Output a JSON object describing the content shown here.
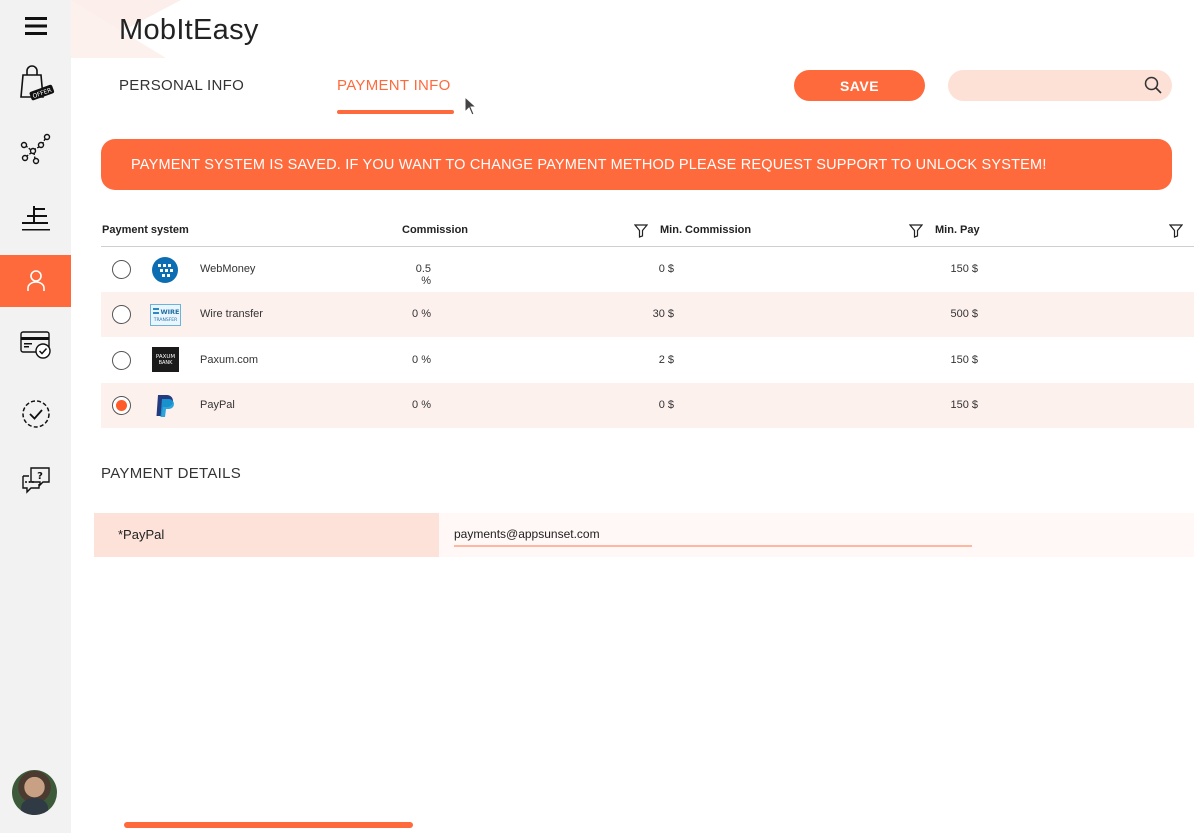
{
  "app": {
    "title": "MobItEasy"
  },
  "tabs": [
    {
      "label": "PERSONAL INFO",
      "active": false
    },
    {
      "label": "PAYMENT INFO",
      "active": true
    }
  ],
  "toolbar": {
    "save_label": "SAVE",
    "search_placeholder": ""
  },
  "banner": {
    "text": "PAYMENT SYSTEM IS SAVED. IF YOU WANT TO CHANGE PAYMENT METHOD PLEASE REQUEST SUPPORT TO UNLOCK SYSTEM!"
  },
  "sidebar": {
    "items": [
      {
        "icon": "menu-icon"
      },
      {
        "icon": "offer-bag-icon",
        "badge": "OFFER"
      },
      {
        "icon": "network-icon"
      },
      {
        "icon": "stats-icon"
      },
      {
        "icon": "user-icon",
        "active": true
      },
      {
        "icon": "payment-card-icon"
      },
      {
        "icon": "check-circle-icon"
      },
      {
        "icon": "support-chat-icon"
      }
    ]
  },
  "table": {
    "columns": [
      "Payment system",
      "Commission",
      "Min. Commission",
      "Min. Pay"
    ],
    "rows": [
      {
        "name": "WebMoney",
        "commission": "0.5 %",
        "min_commission": "0 $",
        "min_pay": "150 $",
        "selected": false,
        "logo": "webmoney-logo"
      },
      {
        "name": "Wire transfer",
        "commission": "0 %",
        "min_commission": "30 $",
        "min_pay": "500 $",
        "selected": false,
        "logo": "wire-transfer-logo",
        "logo_text": "WIRE TRANSFER"
      },
      {
        "name": "Paxum.com",
        "commission": "0 %",
        "min_commission": "2 $",
        "min_pay": "150 $",
        "selected": false,
        "logo": "paxum-logo",
        "logo_text": "PAXUM BANK"
      },
      {
        "name": "PayPal",
        "commission": "0 %",
        "min_commission": "0 $",
        "min_pay": "150 $",
        "selected": true,
        "logo": "paypal-logo"
      }
    ]
  },
  "details": {
    "title": "PAYMENT DETAILS",
    "label": "*PayPal",
    "value": "payments@appsunset.com"
  },
  "colors": {
    "accent": "#ff6a3d",
    "accent_light": "#fde0d6",
    "row_alt": "#fdf1ee"
  }
}
